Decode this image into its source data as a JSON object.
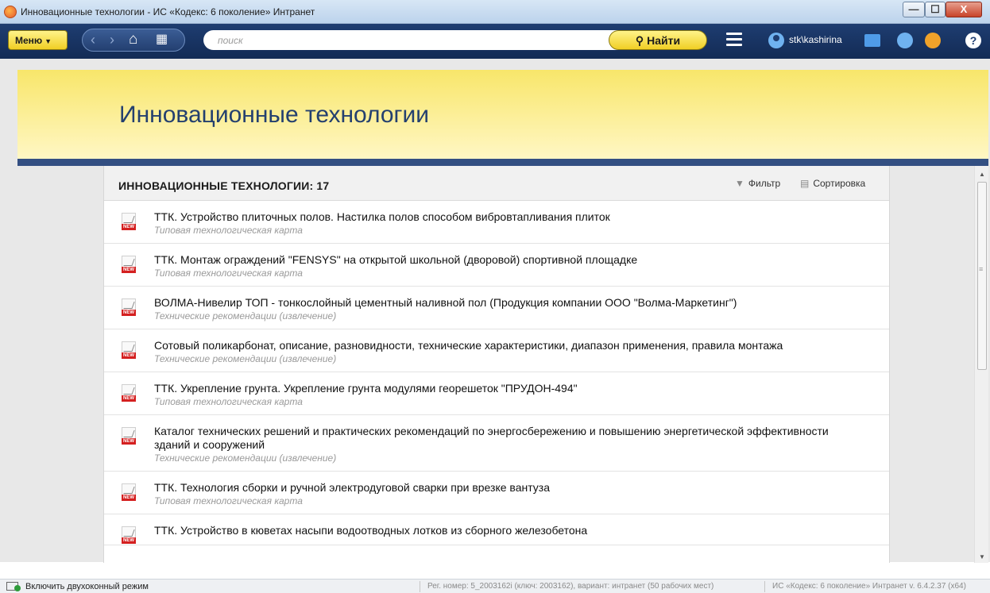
{
  "window": {
    "title": "Инновационные технологии - ИС «Кодекс: 6 поколение» Интранет",
    "minimize": "—",
    "maximize": "☐",
    "close": "X"
  },
  "toolbar": {
    "menu_label": "Меню",
    "menu_caret": "▼",
    "back_glyph": "‹",
    "forward_glyph": "›",
    "home_glyph": "⌂",
    "apps_glyph": "▦",
    "search_placeholder": "поиск",
    "search_button": "Найти",
    "search_icon": "⚲",
    "username": "stk\\kashirina",
    "help_glyph": "?"
  },
  "page": {
    "title": "Инновационные технологии"
  },
  "panel": {
    "heading": "ИННОВАЦИОННЫЕ ТЕХНОЛОГИИ: 17",
    "filter_icon": "▼",
    "filter_label": "Фильтр",
    "sort_icon": "▤",
    "sort_label": "Сортировка"
  },
  "documents": [
    {
      "title": "ТТК. Устройство плиточных полов. Настилка полов способом вибровтапливания плиток",
      "type": "Типовая технологическая карта",
      "badge": "NEW"
    },
    {
      "title": "ТТК. Монтаж ограждений \"FENSYS\" на открытой школьной (дворовой) спортивной площадке",
      "type": "Типовая технологическая карта",
      "badge": "NEW"
    },
    {
      "title": "ВОЛМА-Нивелир ТОП - тонкослойный цементный наливной пол (Продукция компании ООО \"Волма-Маркетинг\")",
      "type": "Технические рекомендации (извлечение)",
      "badge": "NEW"
    },
    {
      "title": "Сотовый поликарбонат, описание, разновидности, технические характеристики, диапазон применения, правила монтажа",
      "type": "Технические рекомендации (извлечение)",
      "badge": "NEW"
    },
    {
      "title": "ТТК. Укрепление грунта. Укрепление грунта модулями георешеток \"ПРУДОН-494\"",
      "type": "Типовая технологическая карта",
      "badge": "NEW"
    },
    {
      "title": "Каталог технических решений и практических рекомендаций по энергосбережению и повышению энергетической эффективности зданий и сооружений",
      "type": "Технические рекомендации (извлечение)",
      "badge": "NEW"
    },
    {
      "title": "ТТК. Технология сборки и ручной электродуговой сварки при врезке вантуза",
      "type": "Типовая технологическая карта",
      "badge": "NEW"
    },
    {
      "title": "ТТК. Устройство в кюветах насыпи водоотводных лотков из сборного железобетона",
      "type": "",
      "badge": "NEW"
    }
  ],
  "scrollbar": {
    "up": "▲",
    "down": "▼",
    "position": 0
  },
  "status": {
    "dual_mode": "Включить двухоконный режим",
    "registration": "Рег. номер: 5_2003162i (ключ: 2003162), вариант: интранет (50 рабочих мест)",
    "version": "ИС «Кодекс: 6 поколение» Интранет v. 6.4.2.37 (x64)"
  }
}
